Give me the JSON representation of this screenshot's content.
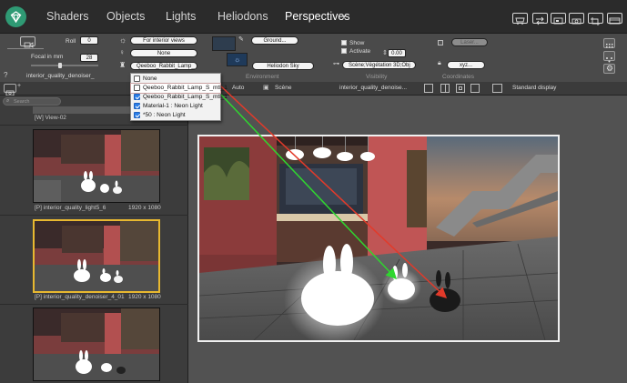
{
  "tabs": [
    {
      "label": "Shaders",
      "active": false
    },
    {
      "label": "Objects",
      "active": false
    },
    {
      "label": "Lights",
      "active": false
    },
    {
      "label": "Heliodons",
      "active": false
    },
    {
      "label": "Perspectives",
      "active": true
    }
  ],
  "camera": {
    "roll_label": "Roll",
    "roll_value": "0",
    "focal_label": "Focal in mm",
    "focal_value": "28",
    "name": "interior_quality_denoiser_"
  },
  "lighting": {
    "sun_preset": "For interior views",
    "lamp_preset": "None",
    "light_object": "Qeeboo_Rabbit_Lamp_"
  },
  "environment": {
    "ground_btn": "Ground...",
    "sky_value": "Heliodon Sky",
    "section": "Environment"
  },
  "visibility": {
    "show_label": "Show",
    "activate_label": "Activate",
    "value": "0.00",
    "scene_value": "Scène;Végétation 3D;Obj",
    "section": "Visibility"
  },
  "coordinates": {
    "laser_btn": "Laser...",
    "xyz_btn": "xyz...",
    "section": "Coordinates"
  },
  "toolbar": {
    "search_placeholder": "Search",
    "auto_label": "Auto",
    "scene_label": "Scène",
    "view_name": "interior_quality_denoise...",
    "display_mode": "Standard display"
  },
  "light_menu": {
    "items": [
      {
        "label": "None",
        "checked": false,
        "highlighted": false
      },
      {
        "label": "Qeeboo_Rabbit_Lamp_S_mtl_1",
        "checked": false,
        "highlighted": true
      },
      {
        "label": "Qeeboo_Rabbit_Lamp_S_mtl_1",
        "checked": true,
        "highlighted": false
      },
      {
        "label": "Material-1 : Neon Light",
        "checked": true,
        "highlighted": false
      },
      {
        "label": "*50 : Neon Light",
        "checked": true,
        "highlighted": false
      }
    ]
  },
  "views": [
    {
      "caption": "[W] View-02"
    },
    {
      "caption": "[P] interior_quality_light5_6",
      "size": "1920 x 1080"
    },
    {
      "caption": "[P] interior_quality_denoiser_4_01",
      "size": "1920 x 1080"
    },
    {
      "caption": "",
      "size": ""
    }
  ],
  "colors": {
    "accent": "#2f9a74",
    "selection": "#e8b830",
    "arrow_red": "#e23a2a",
    "arrow_green": "#2fd62f"
  }
}
